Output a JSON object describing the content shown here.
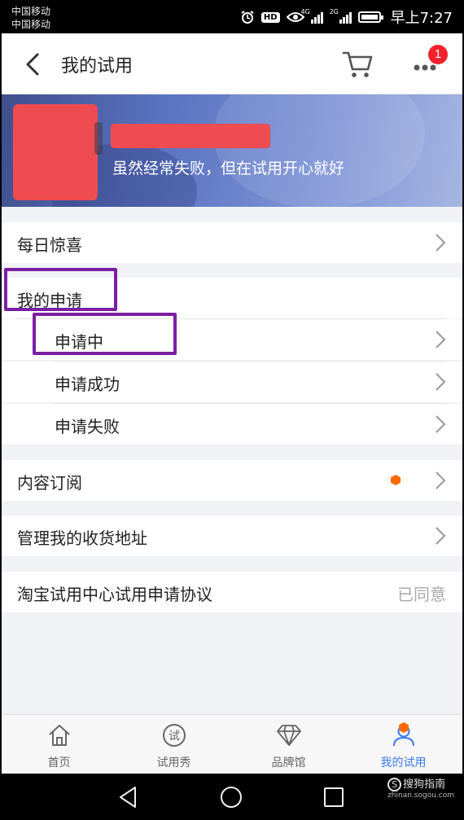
{
  "status_bar": {
    "carrier_1": "中国移动",
    "carrier_2": "中国移动",
    "hd": "HD",
    "net_1": "4G",
    "net_2": "2G",
    "time": "早上7:27"
  },
  "nav": {
    "title": "我的试用",
    "notification_count": "1"
  },
  "profile": {
    "slogan": "虽然经常失败，但在试用开心就好"
  },
  "menu": {
    "daily_surprise": "每日惊喜",
    "my_applications": "我的申请",
    "applying": "申请中",
    "apply_success": "申请成功",
    "apply_failed": "申请失败",
    "content_subscription": "内容订阅",
    "manage_address": "管理我的收货地址",
    "agreement": "淘宝试用中心试用申请协议",
    "agreement_status": "已同意"
  },
  "tabs": [
    {
      "label": "首页",
      "icon": "home-icon"
    },
    {
      "label": "试用秀",
      "icon": "trial-show-icon"
    },
    {
      "label": "品牌馆",
      "icon": "diamond-icon"
    },
    {
      "label": "我的试用",
      "icon": "person-icon",
      "active": true
    }
  ],
  "watermark": {
    "logo": "S",
    "text": "搜狗指南",
    "url": "zhinan.sogou.com"
  },
  "colors": {
    "accent_blue": "#3a7bf0",
    "badge_red": "#f5222d",
    "dot_orange": "#ff6a00",
    "highlight_purple": "#7b1fa2"
  }
}
